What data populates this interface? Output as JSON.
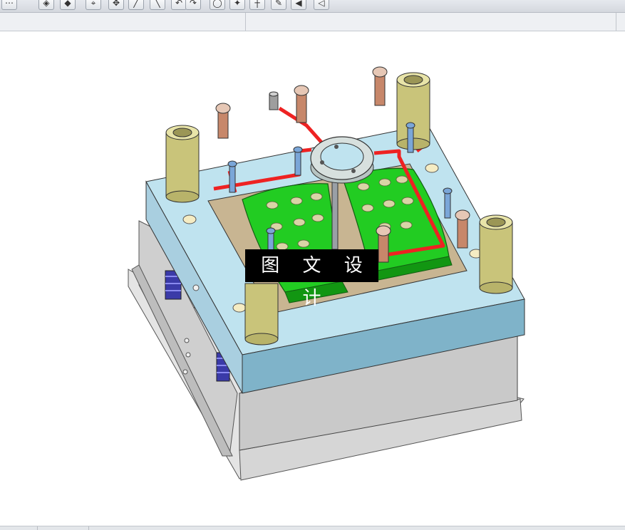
{
  "toolbar": {
    "buttons": [
      {
        "name": "sketch-tool-icon",
        "glyph": "⋯"
      },
      {
        "name": "view-iso-icon",
        "glyph": "◈"
      },
      {
        "name": "view-shaded-icon",
        "glyph": "◆"
      },
      {
        "name": "node-tool-icon",
        "glyph": "⌖"
      },
      {
        "name": "move-icon",
        "glyph": "✥"
      },
      {
        "name": "line-tool-icon",
        "glyph": "╱"
      },
      {
        "name": "arc-tool-icon",
        "glyph": "╲"
      },
      {
        "name": "undo-icon",
        "glyph": "↶"
      },
      {
        "name": "redo-icon",
        "glyph": "↷"
      },
      {
        "name": "circle-tool-icon",
        "glyph": "◯"
      },
      {
        "name": "transform-icon",
        "glyph": "✦"
      },
      {
        "name": "point-tool-icon",
        "glyph": "┼"
      },
      {
        "name": "pencil-tool-icon",
        "glyph": "✎"
      },
      {
        "name": "shape-tool-icon",
        "glyph": "◀"
      },
      {
        "name": "measure-icon",
        "glyph": "◁"
      }
    ]
  },
  "viewport": {
    "model": "injection-mold-assembly",
    "colors": {
      "plate_top": "#bfe3ef",
      "plate_side": "#7fb3c9",
      "base_gray": "#c8c8c8",
      "cavity": "#c8b592",
      "core_green": "#22cc22",
      "cooling": "#ee2222",
      "guide_bushing": "#c9c47a",
      "spring": "#3a3aa8"
    }
  },
  "watermark": {
    "text": "图 文 设 计"
  }
}
